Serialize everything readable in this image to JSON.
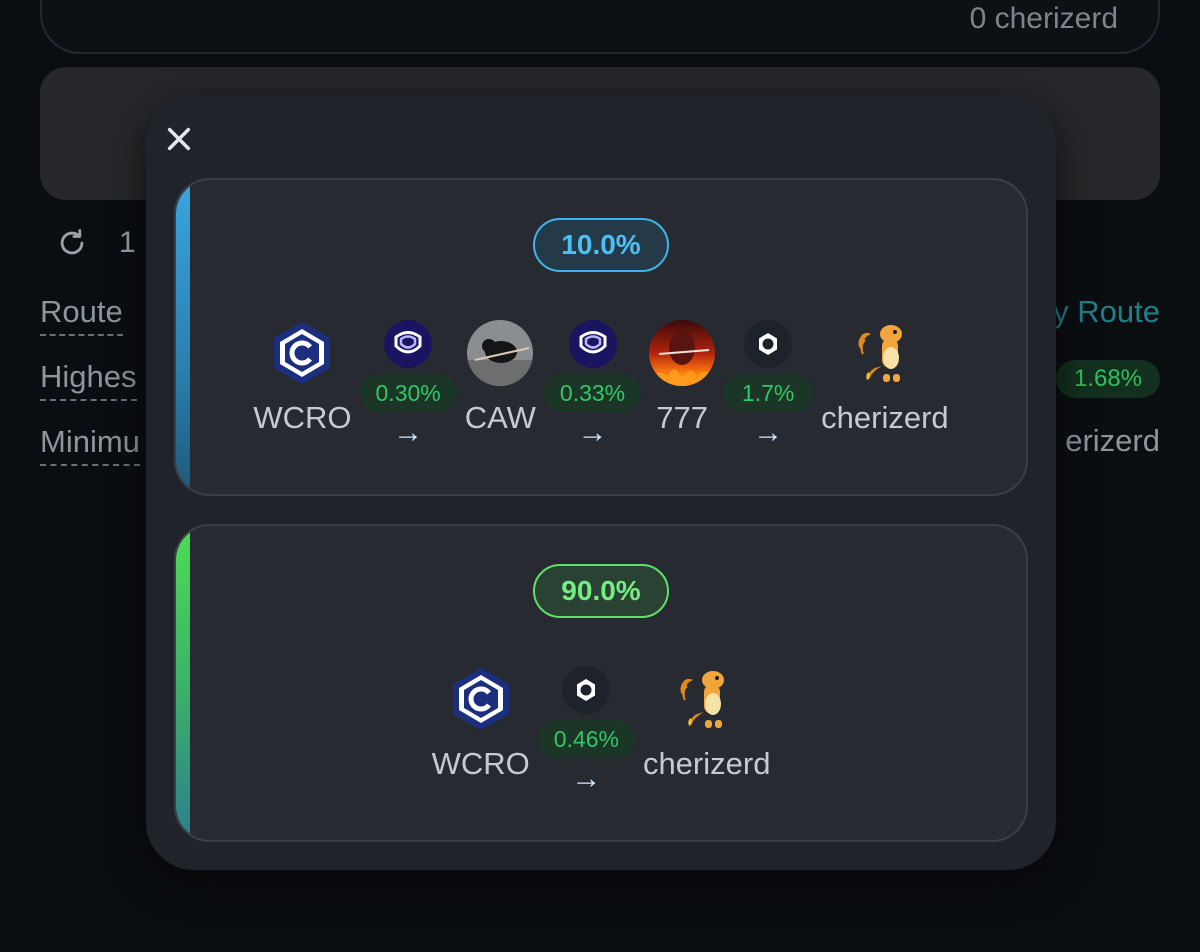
{
  "background": {
    "top_amount": "0 cherizerd",
    "refresh_count": "1",
    "labels": {
      "route": "Route",
      "highest": "Highes",
      "minimum": "Minimu"
    },
    "view_route": "y Route",
    "highest_value": "1.68%",
    "minimum_value": "erizerd"
  },
  "modal": {
    "routes": [
      {
        "share": "10.0%",
        "tokens": [
          "WCRO",
          "CAW",
          "777",
          "cherizerd"
        ],
        "fees": [
          "0.30%",
          "0.33%",
          "1.7%"
        ],
        "arrow": "→"
      },
      {
        "share": "90.0%",
        "tokens": [
          "WCRO",
          "cherizerd"
        ],
        "fees": [
          "0.46%"
        ],
        "arrow": "→"
      }
    ]
  },
  "colors": {
    "accent_blue": "#4cc0f5",
    "accent_green": "#74ee80",
    "fee_green": "#33c667"
  },
  "icons": {
    "close": "close-icon",
    "refresh": "refresh-icon",
    "dex_a": "diamond-dex-icon",
    "dex_b": "ring-dex-icon"
  }
}
